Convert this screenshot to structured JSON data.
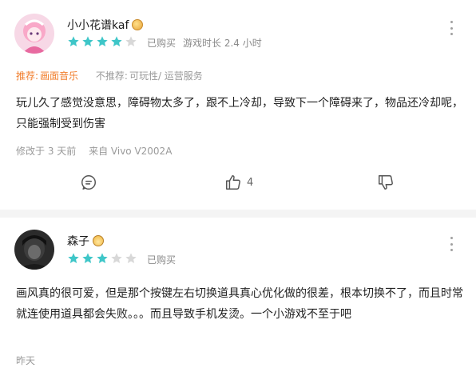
{
  "reviews": [
    {
      "username": "小小花谱kaf",
      "rating": 4,
      "purchase_status": "已购买",
      "playtime": "游戏时长 2.4 小时",
      "recommend_label": "推荐:",
      "recommend_value": "画面音乐",
      "not_recommend_label": "不推荐:",
      "not_recommend_value": "可玩性/ 运营服务",
      "content": "玩儿久了感觉没意思，障碍物太多了，跟不上冷却，导致下一个障碍来了，物品还冷却呢，只能强制受到伤害",
      "modified": "修改于 3 天前",
      "device": "来自 Vivo V2002A",
      "likes": "4"
    },
    {
      "username": "森子",
      "rating": 3,
      "purchase_status": "已购买",
      "content": "画风真的很可爱，但是那个按键左右切换道具真心优化做的很差，根本切换不了，而且时常就连使用道具都会失败。。。而且导致手机发烫。一个小游戏不至于吧",
      "time": "昨天"
    }
  ],
  "colors": {
    "star_filled": "#3ec6c8",
    "star_empty": "#d8d8d8",
    "recommend": "#f17e2c",
    "meta": "#8a8a8a"
  },
  "icons": [
    "comment-icon",
    "thumbs-up-icon",
    "thumbs-down-icon",
    "more-icon",
    "star-icon",
    "badge-icon"
  ]
}
